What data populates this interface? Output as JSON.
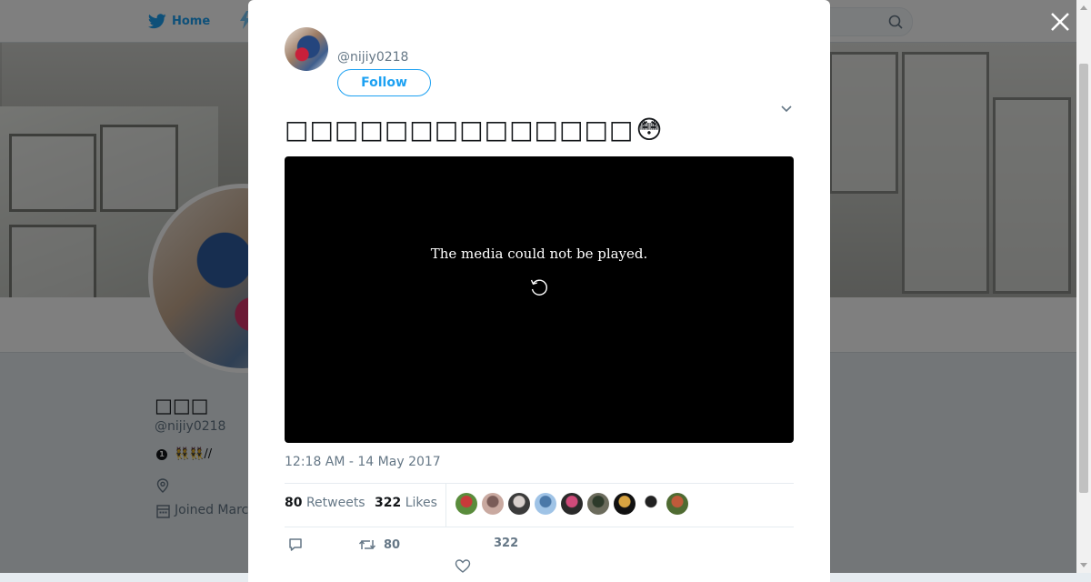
{
  "nav": {
    "home_label": "Home"
  },
  "profile": {
    "name": "□□□",
    "handle": "@nijiy0218",
    "bio_number": "1",
    "bio": "👯👯//",
    "joined": "Joined Marc"
  },
  "modal": {
    "handle": "@nijiy0218",
    "follow_label": "Follow",
    "tweet_text": "□□□□□□□□□□□□□□",
    "tweet_emoji": "😳",
    "media_error": "The media could not be played.",
    "timestamp": "12:18 AM - 14 May 2017",
    "stats": {
      "retweets_count": "80",
      "retweets_label": "Retweets",
      "likes_count": "322",
      "likes_label": "Likes"
    },
    "actions": {
      "retweet_count": "80",
      "like_count": "322"
    }
  },
  "likers": [
    {
      "color_a": "#5a8c3c",
      "color_b": "#c83a3a"
    },
    {
      "color_a": "#c9a9a0",
      "color_b": "#7a5c58"
    },
    {
      "color_a": "#3b3b3b",
      "color_b": "#d8d0cc"
    },
    {
      "color_a": "#9fc3e6",
      "color_b": "#4a78a8"
    },
    {
      "color_a": "#2a2a2a",
      "color_b": "#d04a7a"
    },
    {
      "color_a": "#6b6b5c",
      "color_b": "#2d3a2a"
    },
    {
      "color_a": "#111111",
      "color_b": "#d9a441"
    },
    {
      "color_a": "#ffffff",
      "color_b": "#222222"
    },
    {
      "color_a": "#4f6b32",
      "color_b": "#c05a3a"
    }
  ],
  "colors": {
    "accent": "#1da1f2",
    "text": "#14171a",
    "muted": "#657786"
  }
}
